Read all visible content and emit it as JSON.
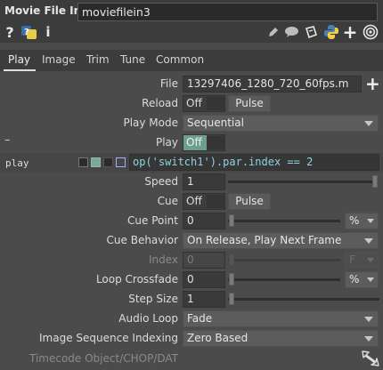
{
  "header": {
    "operator_type": "Movie File In",
    "operator_name": "moviefilein3"
  },
  "toolbar": {
    "left_icons": [
      "help-icon",
      "python-help-icon",
      "info-icon"
    ],
    "right_icons": [
      "edit-icon",
      "comment-icon",
      "clone-icon",
      "python-icon",
      "plus-icon",
      "target-icon"
    ],
    "help_glyph": "?",
    "info_glyph": "i",
    "plus_glyph": "+"
  },
  "tabs": [
    {
      "label": "Play",
      "active": true
    },
    {
      "label": "Image"
    },
    {
      "label": "Trim"
    },
    {
      "label": "Tune"
    },
    {
      "label": "Common"
    }
  ],
  "params": {
    "file": {
      "label": "File",
      "value": "13297406_1280_720_60fps.m"
    },
    "reload": {
      "label": "Reload",
      "toggle": "Off",
      "pulse": "Pulse"
    },
    "play_mode": {
      "label": "Play Mode",
      "value": "Sequential"
    },
    "play": {
      "label": "Play",
      "toggle": "Off",
      "state": "on",
      "side_mark": "–"
    },
    "expression": {
      "name": "play",
      "expr": "op('switch1').par.index == 2"
    },
    "speed": {
      "label": "Speed",
      "value": "1"
    },
    "cue": {
      "label": "Cue",
      "toggle": "Off",
      "pulse": "Pulse"
    },
    "cue_point": {
      "label": "Cue Point",
      "value": "0",
      "unit": "%"
    },
    "cue_behavior": {
      "label": "Cue Behavior",
      "value": "On Release, Play Next Frame"
    },
    "index": {
      "label": "Index",
      "value": "0",
      "unit": "F",
      "disabled": true
    },
    "loop_crossfade": {
      "label": "Loop Crossfade",
      "value": "0",
      "unit": "%"
    },
    "step_size": {
      "label": "Step Size",
      "value": "1"
    },
    "audio_loop": {
      "label": "Audio Loop",
      "value": "Fade"
    },
    "image_sequence_indexing": {
      "label": "Image Sequence Indexing",
      "value": "Zero Based"
    },
    "timecode_object": {
      "label": "Timecode Object/CHOP/DAT",
      "value": "",
      "disabled": true
    }
  },
  "colors": {
    "accent": "#6d9e8f",
    "expression_text": "#8fd3e0",
    "panel_bg": "#4b4b4b",
    "header_bg": "#3c3c3c"
  }
}
